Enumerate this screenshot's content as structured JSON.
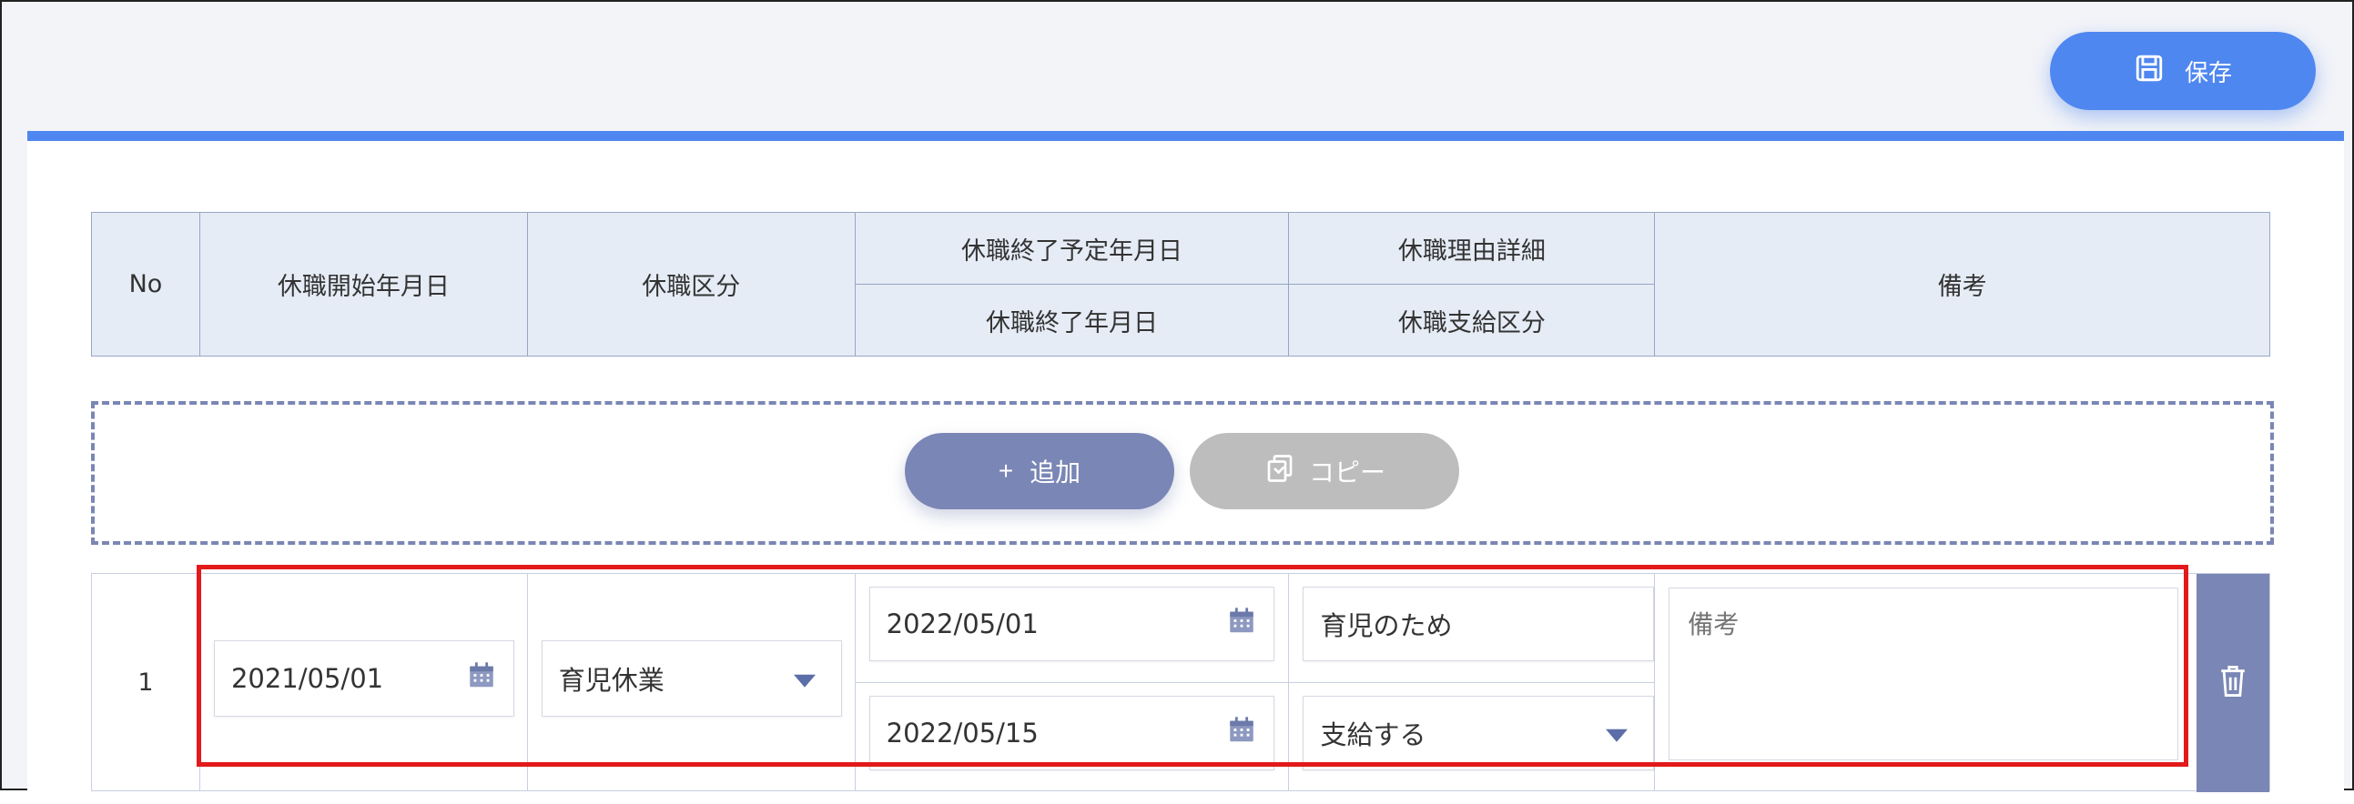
{
  "toolbar": {
    "save_label": "保存"
  },
  "table": {
    "headers": {
      "no": "No",
      "start_date": "休職開始年月日",
      "category": "休職区分",
      "planned_end_date": "休職終了予定年月日",
      "end_date": "休職終了年月日",
      "reason_detail": "休職理由詳細",
      "pay_category": "休職支給区分",
      "remarks": "備考"
    }
  },
  "actions": {
    "add_label": "追加",
    "add_prefix": "+",
    "copy_label": "コピー"
  },
  "rows": [
    {
      "no": "1",
      "start_date": "2021/05/01",
      "category": "育児休業",
      "planned_end_date": "2022/05/01",
      "end_date": "2022/05/15",
      "reason_detail": "育児のため",
      "pay_category": "支給する",
      "remarks_placeholder": "備考"
    }
  ],
  "colors": {
    "accent": "#4f87f0",
    "secondary": "#7a86b5",
    "disabled": "#bdbdbd",
    "highlight": "#e21a1a"
  }
}
